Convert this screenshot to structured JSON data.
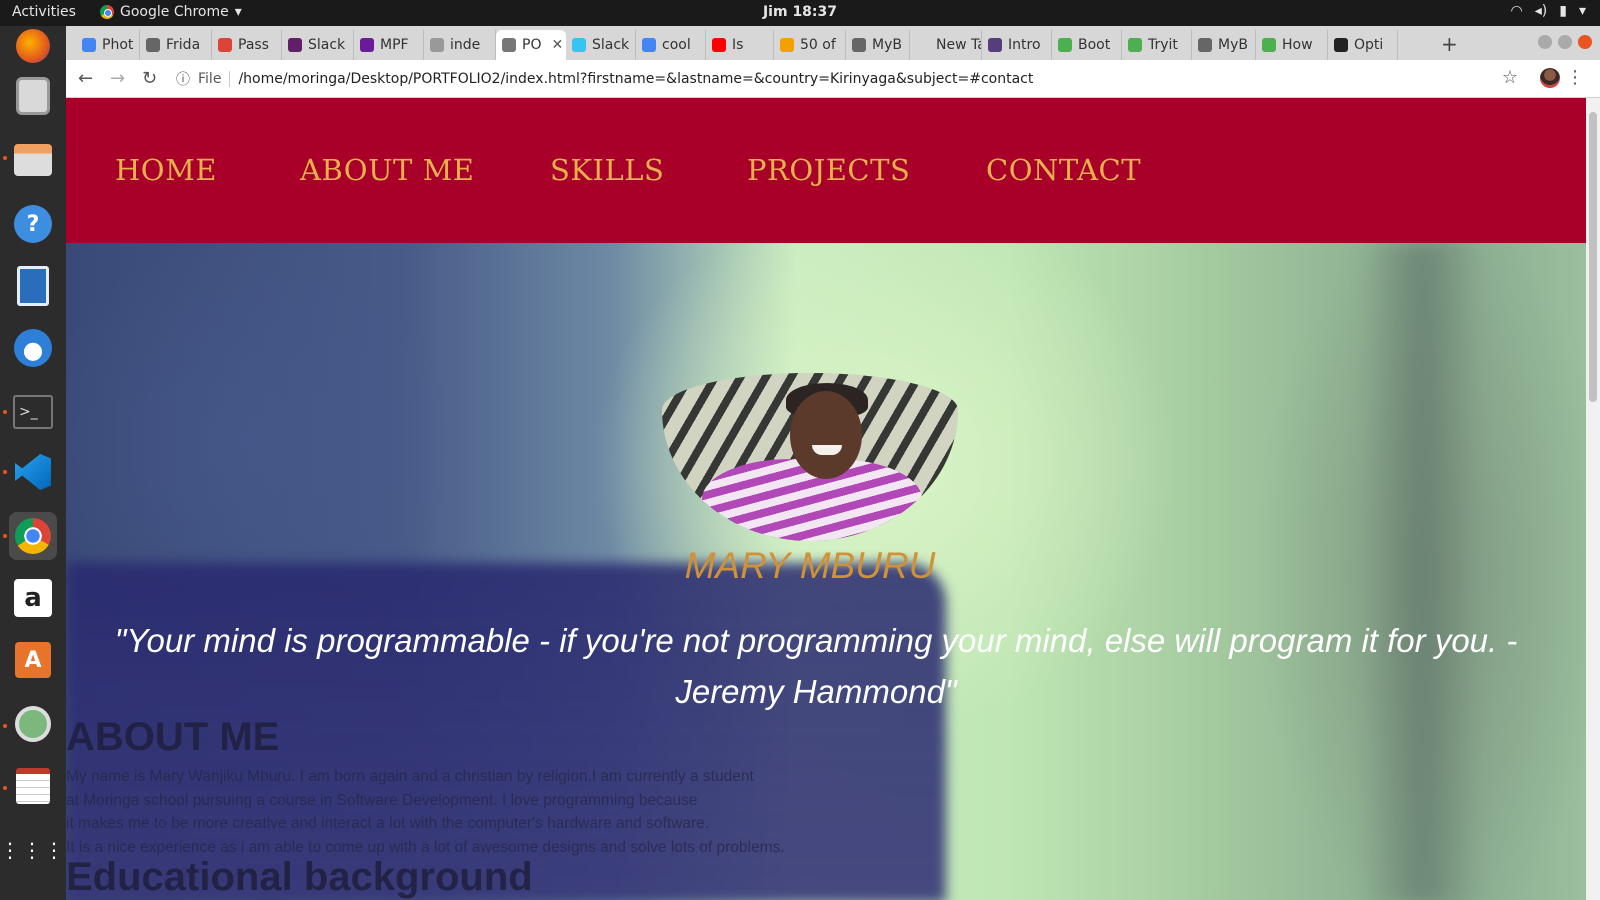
{
  "system_bar": {
    "activities": "Activities",
    "app_name": "Google Chrome",
    "clock": "Jim 18:37"
  },
  "browser": {
    "tabs": [
      {
        "label": "Phot",
        "color": "#4285f4"
      },
      {
        "label": "Frida",
        "color": "#666666"
      },
      {
        "label": "Pass",
        "color": "#db4437"
      },
      {
        "label": "Slack",
        "color": "#611f69"
      },
      {
        "label": "MPF",
        "color": "#6a1b9a"
      },
      {
        "label": "inde",
        "color": "#999999"
      },
      {
        "label": "PO",
        "color": "#777777"
      },
      {
        "label": "Slack",
        "color": "#36c5f0"
      },
      {
        "label": "cool",
        "color": "#4285f4"
      },
      {
        "label": "Is",
        "color": "#ff0000"
      },
      {
        "label": "50 of",
        "color": "#f4a100"
      },
      {
        "label": "MyB",
        "color": "#666666"
      },
      {
        "label": "New Tab",
        "color": "#d7d7d7"
      },
      {
        "label": "Intro",
        "color": "#563d7c"
      },
      {
        "label": "Boot",
        "color": "#4caf50"
      },
      {
        "label": "Tryit",
        "color": "#4caf50"
      },
      {
        "label": "MyB",
        "color": "#666666"
      },
      {
        "label": "How",
        "color": "#4caf50"
      },
      {
        "label": "Opti",
        "color": "#222222"
      }
    ],
    "active_tab_index": 6,
    "address_prefix": "File",
    "url": "/home/moringa/Desktop/PORTFOLIO2/index.html?firstname=&lastname=&country=Kirinyaga&subject=#contact"
  },
  "site": {
    "nav": [
      "HOME",
      "ABOUT ME",
      "SKILLS",
      "PROJECTS",
      "CONTACT"
    ],
    "name": "MARY MBURU",
    "quote_line1": "\"Your mind is programmable - if you're not programming your mind, else will program it for you. -",
    "quote_line2": "Jeremy Hammond\"",
    "about_title": "ABOUT ME",
    "about_lines": [
      "My name is Mary Wanjiku Mburu. I am born again and a christian by religion.I am currently a student",
      "at Moringa school pursuing a course in Software Development. I love programming because",
      "it makes me to be more creative and interact a lot with the computer's hardware and software.",
      "It is a nice experience as i am able to come up with a lot of awesome designs and solve lots of problems."
    ],
    "education_title": "Educational background"
  },
  "colors": {
    "nav_bg": "#a80029",
    "nav_text": "#e8b04d",
    "name_text": "#d19137"
  }
}
